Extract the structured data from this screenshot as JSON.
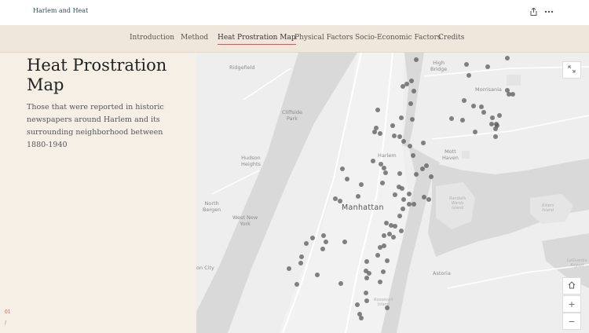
{
  "app": {
    "title": "Harlem and Heat"
  },
  "nav": {
    "items": [
      {
        "label": "Introduction"
      },
      {
        "label": "Method"
      },
      {
        "label": "Heat Prostration Map"
      },
      {
        "label": "Physical Factors"
      },
      {
        "label": "Socio-Economic Factors"
      },
      {
        "label": "Credits"
      }
    ],
    "active": "Heat Prostration Map"
  },
  "panel": {
    "heading": "Heat Prostration Map",
    "description": "Those that were reported in historic newspapers around Harlem and its surrounding neighborhood between 1880-1940",
    "counter_current": "01",
    "counter_sep": "/"
  },
  "map": {
    "labels": {
      "ridgefield": "Ridgefield",
      "high_bridge": "High\nBridge",
      "morrisania": "Morrisania",
      "cliffside_park": "Cliffside\nPark",
      "harlem": "Harlem",
      "mott_haven": "Mott\nHaven",
      "hudson_heights": "Hudson\nHeights",
      "randalls": "Randalls\nWards\nIsland",
      "north_bergen": "North\nBergen",
      "west_new_york": "West New\nYork",
      "manhattan": "Manhattan",
      "rikers": "Rikers\nIsland",
      "on_city": "on City",
      "astoria": "Astoria",
      "laguardia": "LaGuardia\nAirport",
      "roosevelt": "Roosevelt\nIsland"
    },
    "controls": {
      "expand_icon": "expand-icon",
      "home_icon": "home-icon",
      "zoom_in": "+",
      "zoom_out": "−"
    },
    "marker_color": "#555555"
  },
  "colors": {
    "accent": "#c0605a",
    "nav_bg": "#efe7dc",
    "panel_bg": "#f6efe5",
    "water": "#d9d9d9",
    "land": "#eeeeee"
  }
}
